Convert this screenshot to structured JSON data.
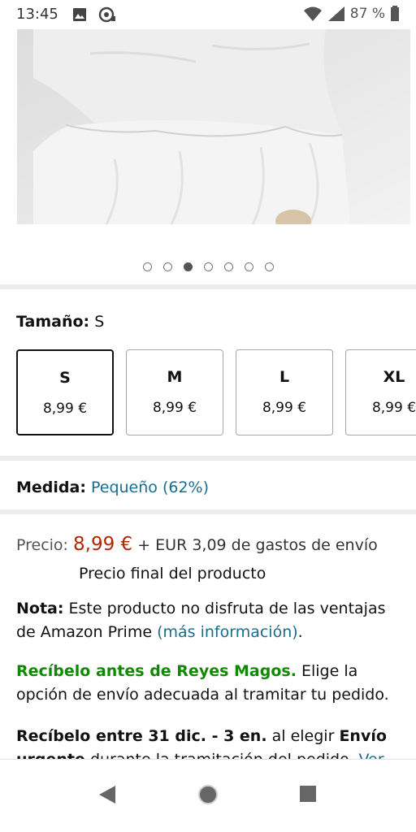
{
  "status_bar": {
    "time": "13:45",
    "battery": "87 %",
    "icons": [
      "image-icon",
      "signal-app-icon",
      "wifi-icon",
      "cell-signal-icon",
      "battery-icon"
    ]
  },
  "carousel": {
    "dot_count": 7,
    "active_index": 2
  },
  "size_selector": {
    "label": "Tamaño:",
    "selected": "S",
    "options": [
      {
        "name": "S",
        "price": "8,99 €"
      },
      {
        "name": "M",
        "price": "8,99 €"
      },
      {
        "name": "L",
        "price": "8,99 €"
      },
      {
        "name": "XL",
        "price": "8,99 €"
      }
    ]
  },
  "fit": {
    "label": "Medida:",
    "value": "Pequeño (62%)"
  },
  "price": {
    "label": "Precio:",
    "value": "8,99 €",
    "shipping": "+ EUR 3,09 de gastos de envío",
    "final_note": "Precio final del producto"
  },
  "note": {
    "label": "Nota:",
    "text": "Este producto no disfruta de las ventajas de Amazon Prime",
    "link": "(más información)",
    "end": "."
  },
  "delivery": {
    "highlight": "Recíbelo antes de Reyes Magos.",
    "text": "Elige la opción de envío adecuada al tramitar tu pedido."
  },
  "delivery2": {
    "lead": "Recíbelo entre 31 dic. - 3 en.",
    "middle": "al elegir",
    "option_bold": "Envío urgente",
    "rest": "durante la tramitación del pedido.",
    "link": "Ver"
  },
  "colors": {
    "price": "#b12704",
    "link": "#1a6c8e",
    "green": "#0f8a00"
  }
}
